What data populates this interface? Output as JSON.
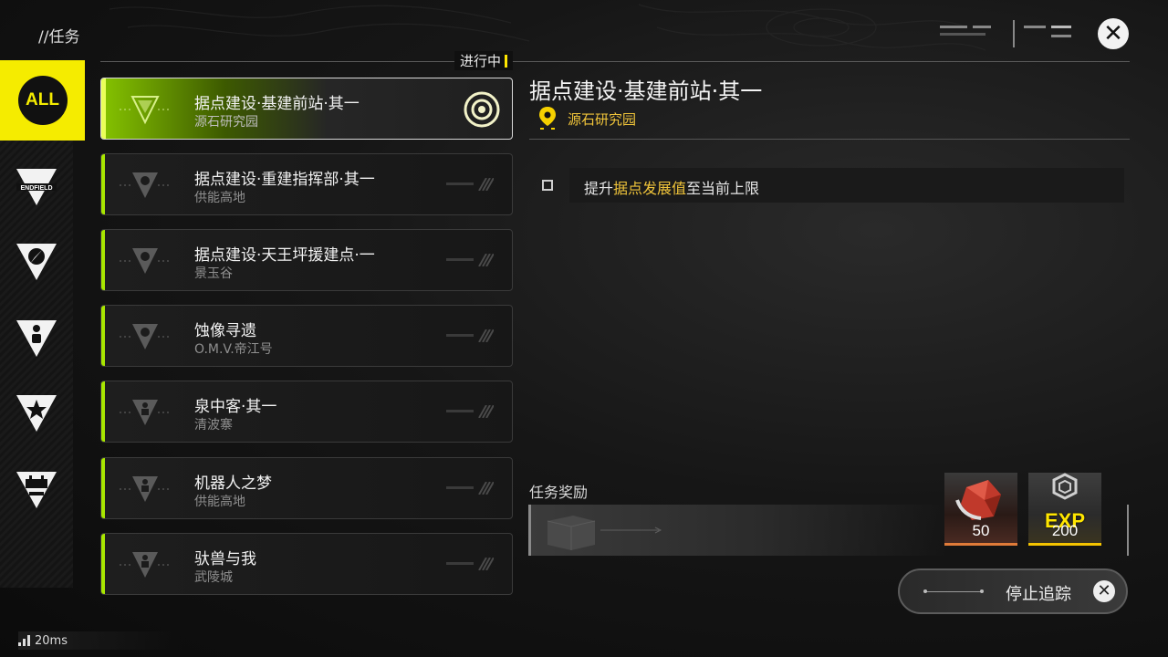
{
  "header": {
    "title": "//任务",
    "in_progress_label": "进行中"
  },
  "sidebar": {
    "items": [
      {
        "id": "all",
        "label": "ALL",
        "icon": "all-icon"
      },
      {
        "id": "endfield",
        "label": "ENDFIELD",
        "icon": "endfield-icon"
      },
      {
        "id": "compass",
        "icon": "compass-icon"
      },
      {
        "id": "person",
        "icon": "person-icon"
      },
      {
        "id": "star",
        "icon": "star-icon"
      },
      {
        "id": "robot",
        "icon": "robot-icon"
      }
    ]
  },
  "quests": [
    {
      "title": "据点建设·基建前站·其一",
      "location": "源石研究园",
      "selected": true
    },
    {
      "title": "据点建设·重建指挥部·其一",
      "location": "供能高地",
      "selected": false
    },
    {
      "title": "据点建设·天王坪援建点·一",
      "location": "景玉谷",
      "selected": false
    },
    {
      "title": "蚀像寻遗",
      "location": "O.M.V.帝江号",
      "selected": false
    },
    {
      "title": "泉中客·其一",
      "location": "清波寨",
      "selected": false
    },
    {
      "title": "机器人之梦",
      "location": "供能高地",
      "selected": false
    },
    {
      "title": "驮兽与我",
      "location": "武陵城",
      "selected": false
    }
  ],
  "detail": {
    "title": "据点建设·基建前站·其一",
    "location": "源石研究园",
    "objective_prefix": "提升",
    "objective_highlight": "据点发展值",
    "objective_suffix": "至当前上限",
    "reward_label": "任务奖励",
    "rewards": [
      {
        "name": "crystal-reward",
        "amount": "50",
        "icon": "crystal-icon"
      },
      {
        "name": "exp-reward",
        "label": "EXP",
        "amount": "200",
        "icon": "exp-icon"
      }
    ]
  },
  "stop_tracking_label": "停止追踪",
  "status": {
    "ping": "20ms"
  },
  "colors": {
    "accent_yellow": "#f5ec00",
    "accent_green": "#a8e600",
    "highlight_text": "#f0c43a"
  }
}
